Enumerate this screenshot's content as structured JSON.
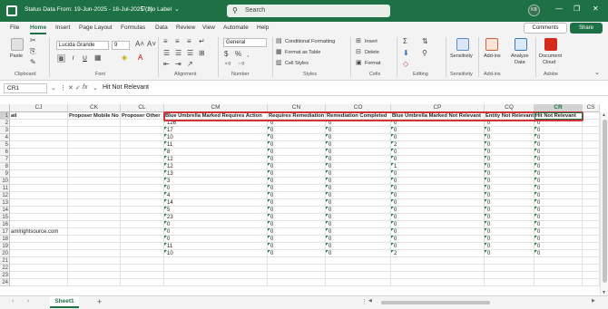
{
  "window": {
    "title": "Status Data From: 19-Jun-2025 - 18-Jul-2025 (2)",
    "sensitivity_label": "No Label",
    "search_placeholder": "Search",
    "user_initials": "KB",
    "min": "—",
    "restore": "❐",
    "close": "✕"
  },
  "tabs": [
    "File",
    "Home",
    "Insert",
    "Page Layout",
    "Formulas",
    "Data",
    "Review",
    "View",
    "Automate",
    "Help"
  ],
  "active_tab": "Home",
  "comments_label": "Comments",
  "share_label": "Share",
  "ribbon": {
    "clipboard": {
      "paste": "Paste",
      "label": "Clipboard"
    },
    "font": {
      "name": "Lucida Grande",
      "size": "9",
      "label": "Font",
      "bold": "B",
      "italic": "I",
      "underline": "U"
    },
    "alignment": {
      "label": "Alignment"
    },
    "number": {
      "format": "General",
      "label": "Number"
    },
    "styles": {
      "conditional": "Conditional Formatting",
      "format_table": "Format as Table",
      "cell_styles": "Cell Styles",
      "label": "Styles"
    },
    "cells": {
      "insert": "Insert",
      "delete": "Delete",
      "format": "Format",
      "label": "Cells"
    },
    "editing": {
      "label": "Editing"
    },
    "sensitivity": {
      "btn": "Sensitivity",
      "label": "Sensitivity"
    },
    "addins": {
      "btn": "Add-ins",
      "label": "Add-ins"
    },
    "analyze": {
      "btn1": "Analyze",
      "btn2": "Data"
    },
    "adobe": {
      "btn1": "Document",
      "btn2": "Cloud",
      "label": "Adobe"
    }
  },
  "formula_bar": {
    "name_box": "CR1",
    "fx": "fx",
    "content": "Hit Not Relevant"
  },
  "grid": {
    "accent": "#1e7145",
    "highlight": "#d13438",
    "columns": [
      "CJ",
      "CK",
      "CL",
      "CM",
      "CN",
      "CO",
      "CP",
      "CQ",
      "CR",
      "CS"
    ],
    "selected_column": "CR",
    "row_numbers": [
      "1",
      "2",
      "3",
      "4",
      "5",
      "6",
      "7",
      "8",
      "9",
      "10",
      "11",
      "12",
      "13",
      "14",
      "15",
      "16",
      "17",
      "18",
      "19",
      "20",
      "21",
      "22",
      "23",
      "24"
    ],
    "header_row": [
      "ail",
      "Proposer Mobile No",
      "Proposer Other",
      "Blue Umbrella Marked Requires Action",
      "Requires Remediation",
      "Remediation Completed",
      "Blue Umbrella Marked Not Relevant",
      "Entity Not Relevant",
      "Hit Not Relevant",
      ""
    ],
    "rows": [
      {
        "cj": "",
        "cm": "126",
        "cn": "0",
        "co": "0",
        "cp": "0",
        "cq": "0",
        "cr": "0"
      },
      {
        "cj": "",
        "cm": "17",
        "cn": "0",
        "co": "0",
        "cp": "0",
        "cq": "0",
        "cr": "0"
      },
      {
        "cj": "",
        "cm": "10",
        "cn": "0",
        "co": "0",
        "cp": "0",
        "cq": "0",
        "cr": "0"
      },
      {
        "cj": "",
        "cm": "11",
        "cn": "0",
        "co": "0",
        "cp": "2",
        "cq": "0",
        "cr": "0"
      },
      {
        "cj": "",
        "cm": "8",
        "cn": "0",
        "co": "0",
        "cp": "0",
        "cq": "0",
        "cr": "0"
      },
      {
        "cj": "",
        "cm": "12",
        "cn": "0",
        "co": "0",
        "cp": "0",
        "cq": "0",
        "cr": "0"
      },
      {
        "cj": "",
        "cm": "12",
        "cn": "0",
        "co": "0",
        "cp": "1",
        "cq": "0",
        "cr": "0"
      },
      {
        "cj": "",
        "cm": "13",
        "cn": "0",
        "co": "0",
        "cp": "0",
        "cq": "0",
        "cr": "0"
      },
      {
        "cj": "",
        "cm": "3",
        "cn": "0",
        "co": "0",
        "cp": "0",
        "cq": "0",
        "cr": "0"
      },
      {
        "cj": "",
        "cm": "0",
        "cn": "0",
        "co": "0",
        "cp": "0",
        "cq": "0",
        "cr": "0"
      },
      {
        "cj": "",
        "cm": "4",
        "cn": "0",
        "co": "0",
        "cp": "0",
        "cq": "0",
        "cr": "0"
      },
      {
        "cj": "",
        "cm": "14",
        "cn": "0",
        "co": "0",
        "cp": "0",
        "cq": "0",
        "cr": "0"
      },
      {
        "cj": "",
        "cm": "5",
        "cn": "0",
        "co": "0",
        "cp": "0",
        "cq": "0",
        "cr": "0"
      },
      {
        "cj": "",
        "cm": "23",
        "cn": "0",
        "co": "0",
        "cp": "0",
        "cq": "0",
        "cr": "0"
      },
      {
        "cj": "",
        "cm": "0",
        "cn": "0",
        "co": "0",
        "cp": "0",
        "cq": "0",
        "cr": "0"
      },
      {
        "cj": "amlrightsource.com",
        "cm": "0",
        "cn": "0",
        "co": "0",
        "cp": "0",
        "cq": "0",
        "cr": "0"
      },
      {
        "cj": "",
        "cm": "0",
        "cn": "0",
        "co": "0",
        "cp": "0",
        "cq": "0",
        "cr": "0"
      },
      {
        "cj": "",
        "cm": "11",
        "cn": "0",
        "co": "0",
        "cp": "0",
        "cq": "0",
        "cr": "0"
      },
      {
        "cj": "",
        "cm": "10",
        "cn": "0",
        "co": "0",
        "cp": "2",
        "cq": "0",
        "cr": "0"
      }
    ]
  },
  "sheet_tab": "Sheet1",
  "add_sheet": "+"
}
